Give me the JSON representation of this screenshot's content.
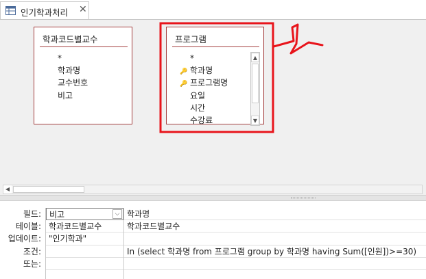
{
  "tab": {
    "label": "인기학과처리",
    "close": "✕"
  },
  "tables": [
    {
      "title": "학과코드별교수",
      "fields": [
        {
          "name": "*",
          "key": false
        },
        {
          "name": "학과명",
          "key": false
        },
        {
          "name": "교수번호",
          "key": false
        },
        {
          "name": "비고",
          "key": false
        }
      ]
    },
    {
      "title": "프로그램",
      "fields": [
        {
          "name": "*",
          "key": false
        },
        {
          "name": "학과명",
          "key": true
        },
        {
          "name": "프로그램명",
          "key": true
        },
        {
          "name": "요일",
          "key": false
        },
        {
          "name": "시간",
          "key": false
        },
        {
          "name": "수강료",
          "key": false
        }
      ]
    }
  ],
  "grid": {
    "row_labels": [
      "필드:",
      "테이블:",
      "업데이트:",
      "조건:",
      "또는:"
    ],
    "columns": [
      {
        "field": "비고",
        "table": "학과코드별교수",
        "update": "\"인기학과\"",
        "criteria": "",
        "or": ""
      },
      {
        "field": "학과명",
        "table": "학과코드별교수",
        "update": "",
        "criteria": "In (select 학과명 from 프로그램 group by 학과명 having Sum([인원])>=30)",
        "or": ""
      }
    ]
  },
  "annotation": {
    "color": "#e8141b"
  },
  "colors": {
    "table_border": "#a33c3c",
    "pane": "#f0f0f0"
  }
}
